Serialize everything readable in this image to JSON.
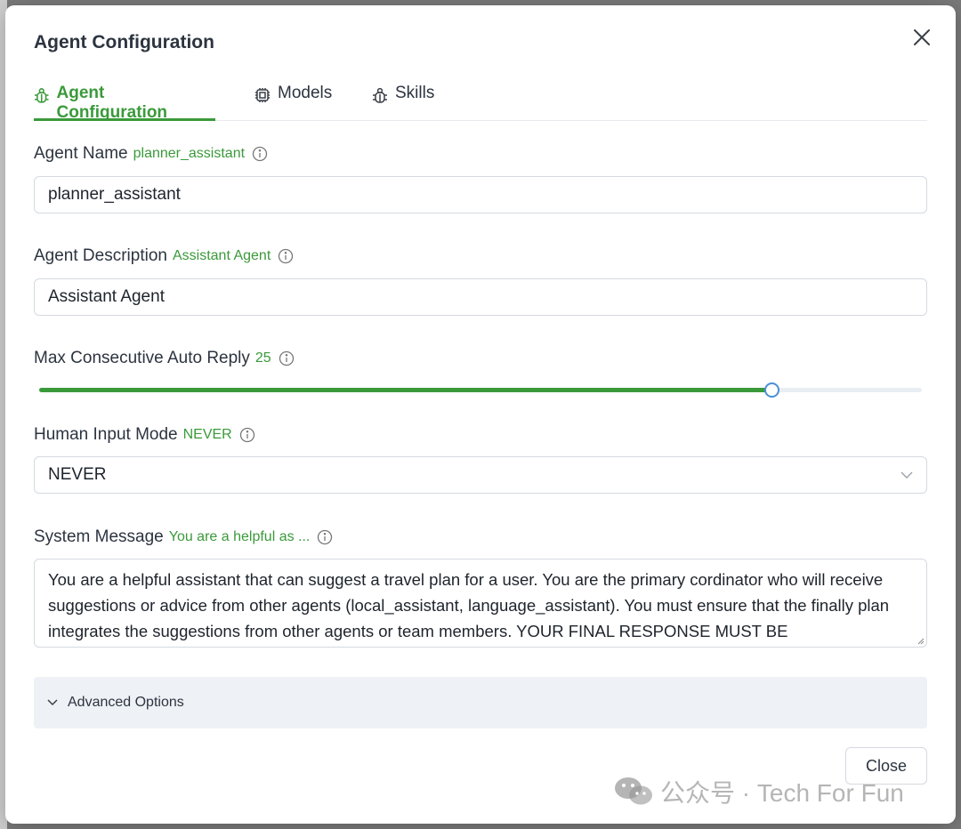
{
  "dialog": {
    "title": "Agent Configuration"
  },
  "tabs": [
    {
      "label": "Agent Configuration",
      "icon": "bug-icon",
      "active": true
    },
    {
      "label": "Models",
      "icon": "cpu-icon",
      "active": false
    },
    {
      "label": "Skills",
      "icon": "robot-icon",
      "active": false
    }
  ],
  "fields": {
    "agent_name": {
      "label": "Agent Name",
      "hint": "planner_assistant",
      "value": "planner_assistant"
    },
    "agent_description": {
      "label": "Agent Description",
      "hint": "Assistant Agent",
      "value": "Assistant Agent"
    },
    "max_auto_reply": {
      "label": "Max Consecutive Auto Reply",
      "hint": "25",
      "slider_fraction": 0.83
    },
    "human_input_mode": {
      "label": "Human Input Mode",
      "hint": "NEVER",
      "value": "NEVER"
    },
    "system_message": {
      "label": "System Message",
      "hint": "You are a helpful as ...",
      "value": "You are a helpful assistant that can suggest a travel plan for a user. You are the primary cordinator who will receive suggestions or advice from other agents (local_assistant, language_assistant). You must ensure that the finally plan integrates the suggestions from other agents or team members. YOUR FINAL RESPONSE MUST BE"
    }
  },
  "advanced": {
    "label": "Advanced Options"
  },
  "footer": {
    "close_label": "Close"
  },
  "watermark": {
    "text": "公众号 · Tech For Fun"
  },
  "colors": {
    "accent": "#3a9a3a",
    "slider_thumb": "#4a90d9"
  }
}
